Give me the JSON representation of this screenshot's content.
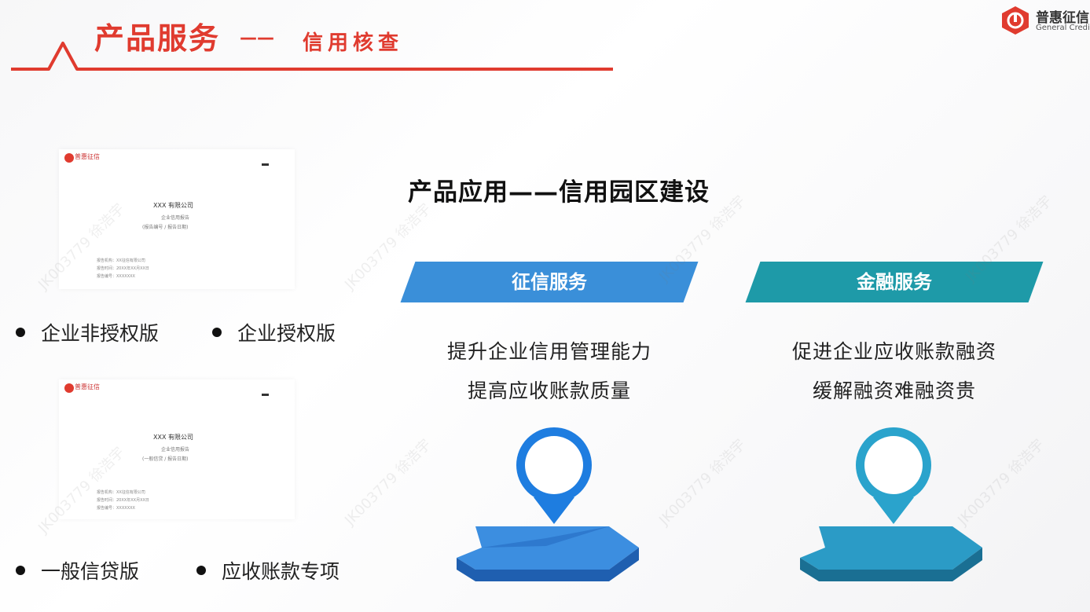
{
  "header": {
    "title": "产品服务",
    "dash": "——",
    "subtitle": "信用核查",
    "accent_color": "#e03b2f"
  },
  "logo": {
    "name": "普惠征信",
    "english": "General Credit",
    "icon": "brand-logo-icon"
  },
  "documents": [
    {
      "brand": "普惠征信",
      "company": "XXX 有限公司",
      "report_type": "企业信用报告",
      "meta": "(报告编号 / 报告日期)",
      "lines": [
        "报告机构：XX征信有限公司",
        "报告时间：20XX年XX月XX日",
        "报告编号：XXXXXXX"
      ]
    },
    {
      "brand": "普惠征信",
      "company": "XXX 有限公司",
      "report_type": "企业信用报告",
      "meta": "(一般信贷 / 报告日期)",
      "lines": [
        "报告机构：XX征信有限公司",
        "报告时间：20XX年XX月XX日",
        "报告编号：XXXXXXX"
      ]
    }
  ],
  "bullets": {
    "row1": [
      "企业非授权版",
      "企业授权版"
    ],
    "row2": [
      "一般信贷版",
      "应收账款专项"
    ]
  },
  "section": {
    "title": "产品应用——信用园区建设",
    "cards": [
      {
        "label": "征信服务",
        "lines": [
          "提升企业信用管理能力",
          "提高应收账款质量"
        ],
        "color": "#3a8fd9",
        "icon": "location-pin-icon"
      },
      {
        "label": "金融服务",
        "lines": [
          "促进企业应收账款融资",
          "缓解融资难融资贵"
        ],
        "color": "#1e9aa8",
        "icon": "location-pin-icon"
      }
    ]
  },
  "watermark": "JK003779 徐浩宇"
}
